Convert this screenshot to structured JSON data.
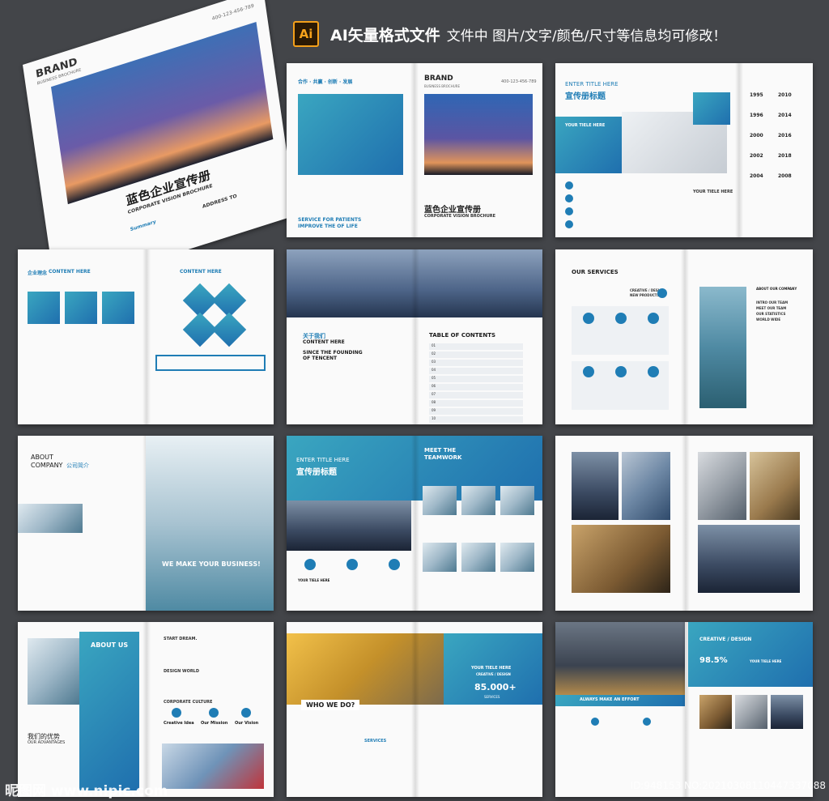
{
  "header": {
    "icon_text": "Ai",
    "main": "AI矢量格式文件",
    "sub": "文件中 图片/文字/颜色/尺寸等信息均可修改！"
  },
  "cover": {
    "brand": "BRAND",
    "brand_sub": "BUSINESS BROCHURE",
    "title_cn": "蓝色企业宣传册",
    "title_en": "CORPORATE VISION BROCHURE",
    "summary_label": "Summary",
    "address_label": "ADDRESS TO",
    "phone": "400-123-456-789"
  },
  "spread1": {
    "tagline": "合作 · 共赢 · 创新 · 发展",
    "brand": "BRAND",
    "brand_sub": "BUSINESS BROCHURE",
    "phone": "400-123-456-789",
    "service": "SERVICE FOR PATIENTS",
    "improve": "IMPROVE THE OF LIFE",
    "title_cn": "蓝色企业宣传册",
    "title_en": "CORPORATE VISION BROCHURE"
  },
  "spread2": {
    "enter_title": "ENTER TITLE HERE",
    "title_cn": "宣传册标题",
    "your_title": "YOUR TIELE HERE",
    "your_title2": "YOUR TIELE HERE",
    "years": [
      "1995",
      "2010",
      "1996",
      "2014",
      "2000",
      "2016",
      "2002",
      "2018",
      "2004",
      "2008"
    ]
  },
  "spread3": {
    "left_title": "企业理念",
    "content": "CONTENT HERE",
    "content2": "CONTENT HERE"
  },
  "spread4": {
    "about_cn": "关于我们",
    "content": "CONTENT HERE",
    "since": "SINCE THE FOUNDING",
    "of": "OF TENCENT",
    "toc": "TABLE OF CONTENTS",
    "toc_items": [
      "01",
      "02",
      "03",
      "04",
      "05",
      "06",
      "07",
      "08",
      "09",
      "10"
    ]
  },
  "spread5": {
    "services": "OUR SERVICES",
    "creative": "CREATIVE / DESIGN",
    "new_products": "NEW PRODUCTS",
    "about_company": "ABOUT OUR COMPANY",
    "bullets": [
      "INTRO OUR TEAM",
      "MEET OUR TEAM",
      "OUR STATISTICS",
      "WORLD WIDE"
    ]
  },
  "spread6": {
    "about": "ABOUT",
    "company": "COMPANY",
    "company_cn": "公司简介",
    "we_make": "WE MAKE YOUR BUSINESS!"
  },
  "spread7": {
    "enter_title": "ENTER TITLE HERE",
    "title_cn": "宣传册标题",
    "meet": "MEET THE",
    "team": "TEAMWORK",
    "your_title": "YOUR TIELE HERE"
  },
  "spread9": {
    "about_us": "ABOUT US",
    "start": "START DREAM.",
    "design": "DESIGN WORLD",
    "culture": "CORPORATE CULTURE",
    "creative_idea": "Creative Idea",
    "our_mission": "Our Mission",
    "our_vision": "Our Vision",
    "adv_cn": "我们的优势",
    "adv_en": "OUR ADVANTAGES"
  },
  "spread10": {
    "who": "WHO WE DO?",
    "services": "SERVICES",
    "your_title": "YOUR TIELE HERE",
    "creative": "CREATIVE / DESIGN",
    "new_products": "NEW PRODUCTS",
    "number": "85.000+",
    "services_small": "SERVICES"
  },
  "spread11": {
    "creative": "CREATIVE / DESIGN",
    "percent": "98.5%",
    "your_title": "YOUR TIELE HERE",
    "always": "ALWAYS MAKE AN EFFORT"
  },
  "watermark": {
    "left": "昵图网 www.nipic.com",
    "right": "ID:948153 NO:20210308110447337088"
  },
  "colors": {
    "accent": "#1f7db5",
    "teal": "#3aa6c0",
    "background": "#434549",
    "ai_orange": "#f7a21b"
  }
}
